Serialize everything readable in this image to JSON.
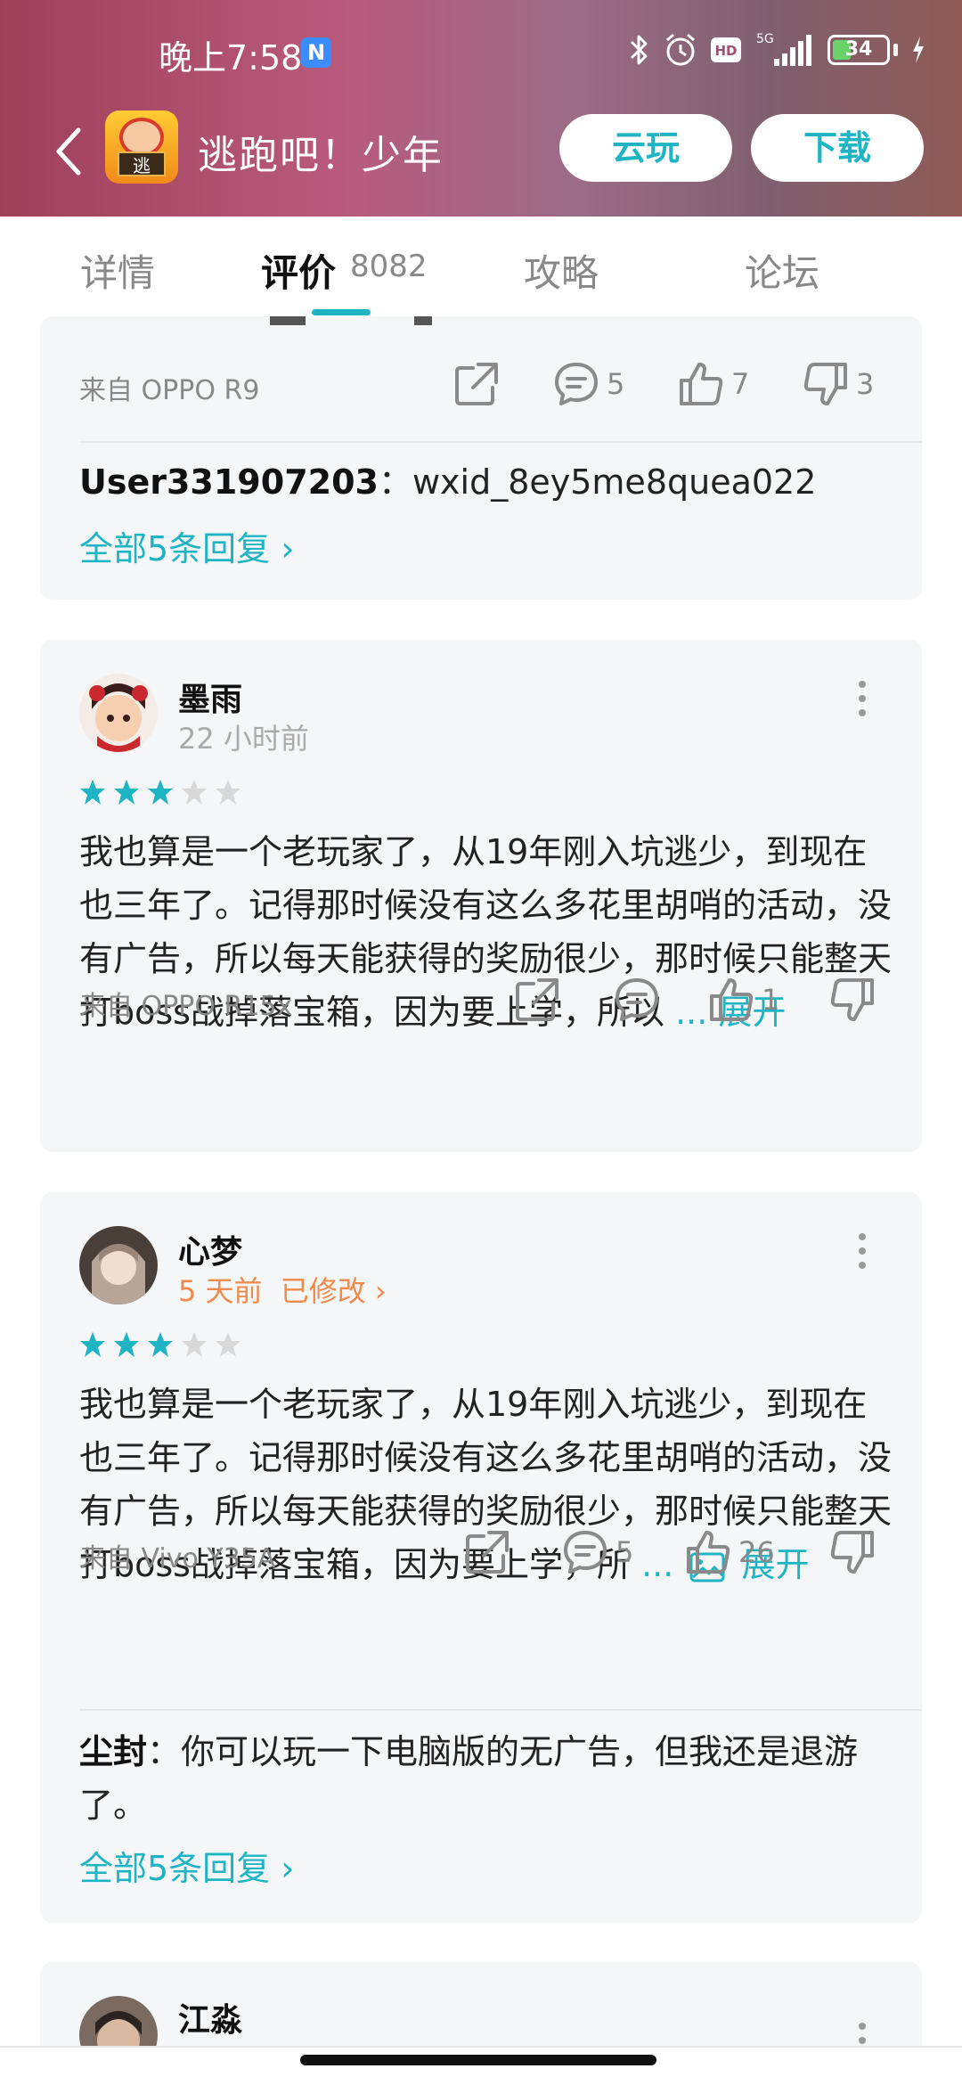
{
  "status_bar": {
    "time": "晚上7:58",
    "notification_badge": "N",
    "battery_level": "34",
    "network": "5G"
  },
  "app": {
    "title": "逃跑吧！少年",
    "icon_text": "逃",
    "cloud_play_label": "云玩",
    "download_label": "下载"
  },
  "tabs": [
    {
      "label": "详情"
    },
    {
      "label": "评价",
      "count": "8082",
      "active": true
    },
    {
      "label": "攻略"
    },
    {
      "label": "论坛"
    }
  ],
  "reviews": [
    {
      "device": "来自 OPPO R9",
      "share_count": "",
      "comment_count": "5",
      "like_count": "7",
      "dislike_count": "3",
      "reply": {
        "user": "User331907203",
        "text": "：wxid_8ey5me8quea022"
      },
      "more_replies": "全部5条回复 ›"
    },
    {
      "username": "墨雨",
      "time": "22 小时前",
      "rating": 3,
      "text": "我也算是一个老玩家了，从19年刚入坑逃少，到现在也三年了。记得那时候没有这么多花里胡哨的活动，没有广告，所以每天能获得的奖励很少，那时候只能整天打boss战掉落宝箱，因为要上学，所以",
      "ellipsis": "...",
      "expand_label": "展开",
      "device": "来自 OPPO R15x",
      "like_count": "1"
    },
    {
      "username": "心梦",
      "time": "5 天前",
      "edited_label": "已修改 ›",
      "rating": 3,
      "text": "我也算是一个老玩家了，从19年刚入坑逃少，到现在也三年了。记得那时候没有这么多花里胡哨的活动，没有广告，所以每天能获得的奖励很少，那时候只能整天打boss战掉落宝箱，因为要上学，所",
      "ellipsis": "...",
      "expand_label": "展开",
      "device": "来自 Vivo Y35A",
      "comment_count": "5",
      "like_count": "26",
      "reply": {
        "user": "尘封",
        "text": "：你可以玩一下电脑版的无广告，但我还是退游了。"
      },
      "more_replies": "全部5条回复 ›"
    },
    {
      "username": "江淼"
    }
  ],
  "colors": {
    "accent": "#1fb4c4",
    "edited": "#f08a4b",
    "star_on": "#1fb4c4",
    "star_off": "#d8d8d8"
  }
}
